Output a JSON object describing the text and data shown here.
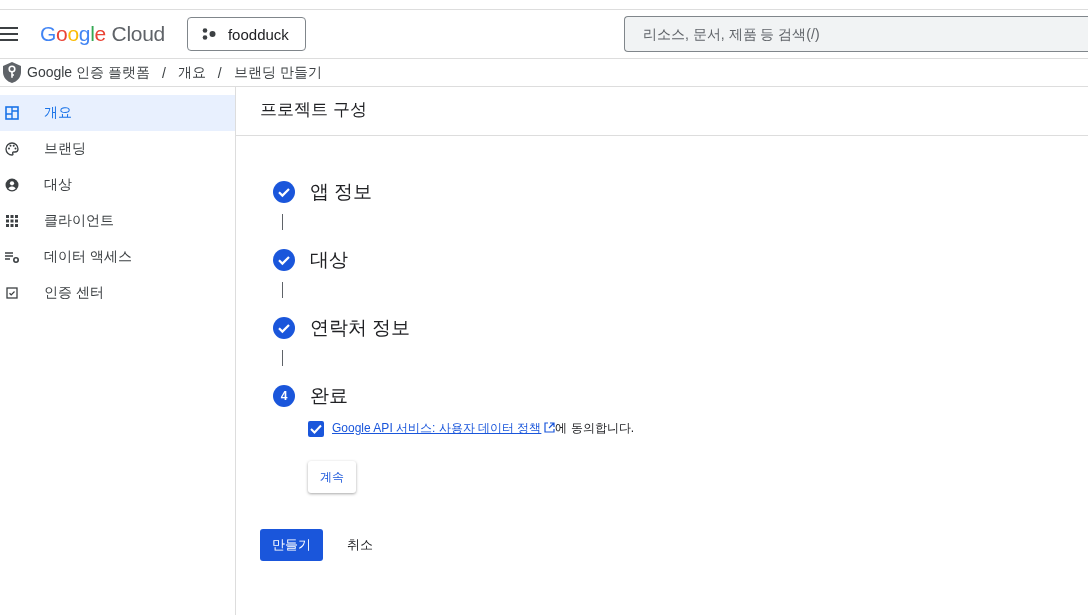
{
  "header": {
    "logo": "Google Cloud",
    "project": "foodduck",
    "search": {
      "placeholder": "리소스, 문서, 제품 등 검색(/)"
    }
  },
  "breadcrumb": [
    "Google 인증 플랫폼",
    "개요",
    "브랜딩 만들기"
  ],
  "breadcrumb_separator": "/",
  "sidebar": {
    "items": [
      {
        "label": "개요",
        "selected": true
      },
      {
        "label": "브랜딩",
        "selected": false
      },
      {
        "label": "대상",
        "selected": false
      },
      {
        "label": "클라이언트",
        "selected": false
      },
      {
        "label": "데이터 액세스",
        "selected": false
      },
      {
        "label": "인증 센터",
        "selected": false
      }
    ]
  },
  "page_title": "프로젝트 구성",
  "steps": [
    {
      "label": "앱 정보",
      "completed": true
    },
    {
      "label": "대상",
      "completed": true
    },
    {
      "label": "연락처 정보",
      "completed": true
    },
    {
      "label": "완료",
      "completed": false,
      "number": "4"
    }
  ],
  "agreement": {
    "checked": true,
    "link": "Google API 서비스: 사용자 데이터 정책",
    "suffix": "에 동의합니다."
  },
  "continue_button": "계속",
  "create_button": "만들기",
  "cancel_button": "취소"
}
